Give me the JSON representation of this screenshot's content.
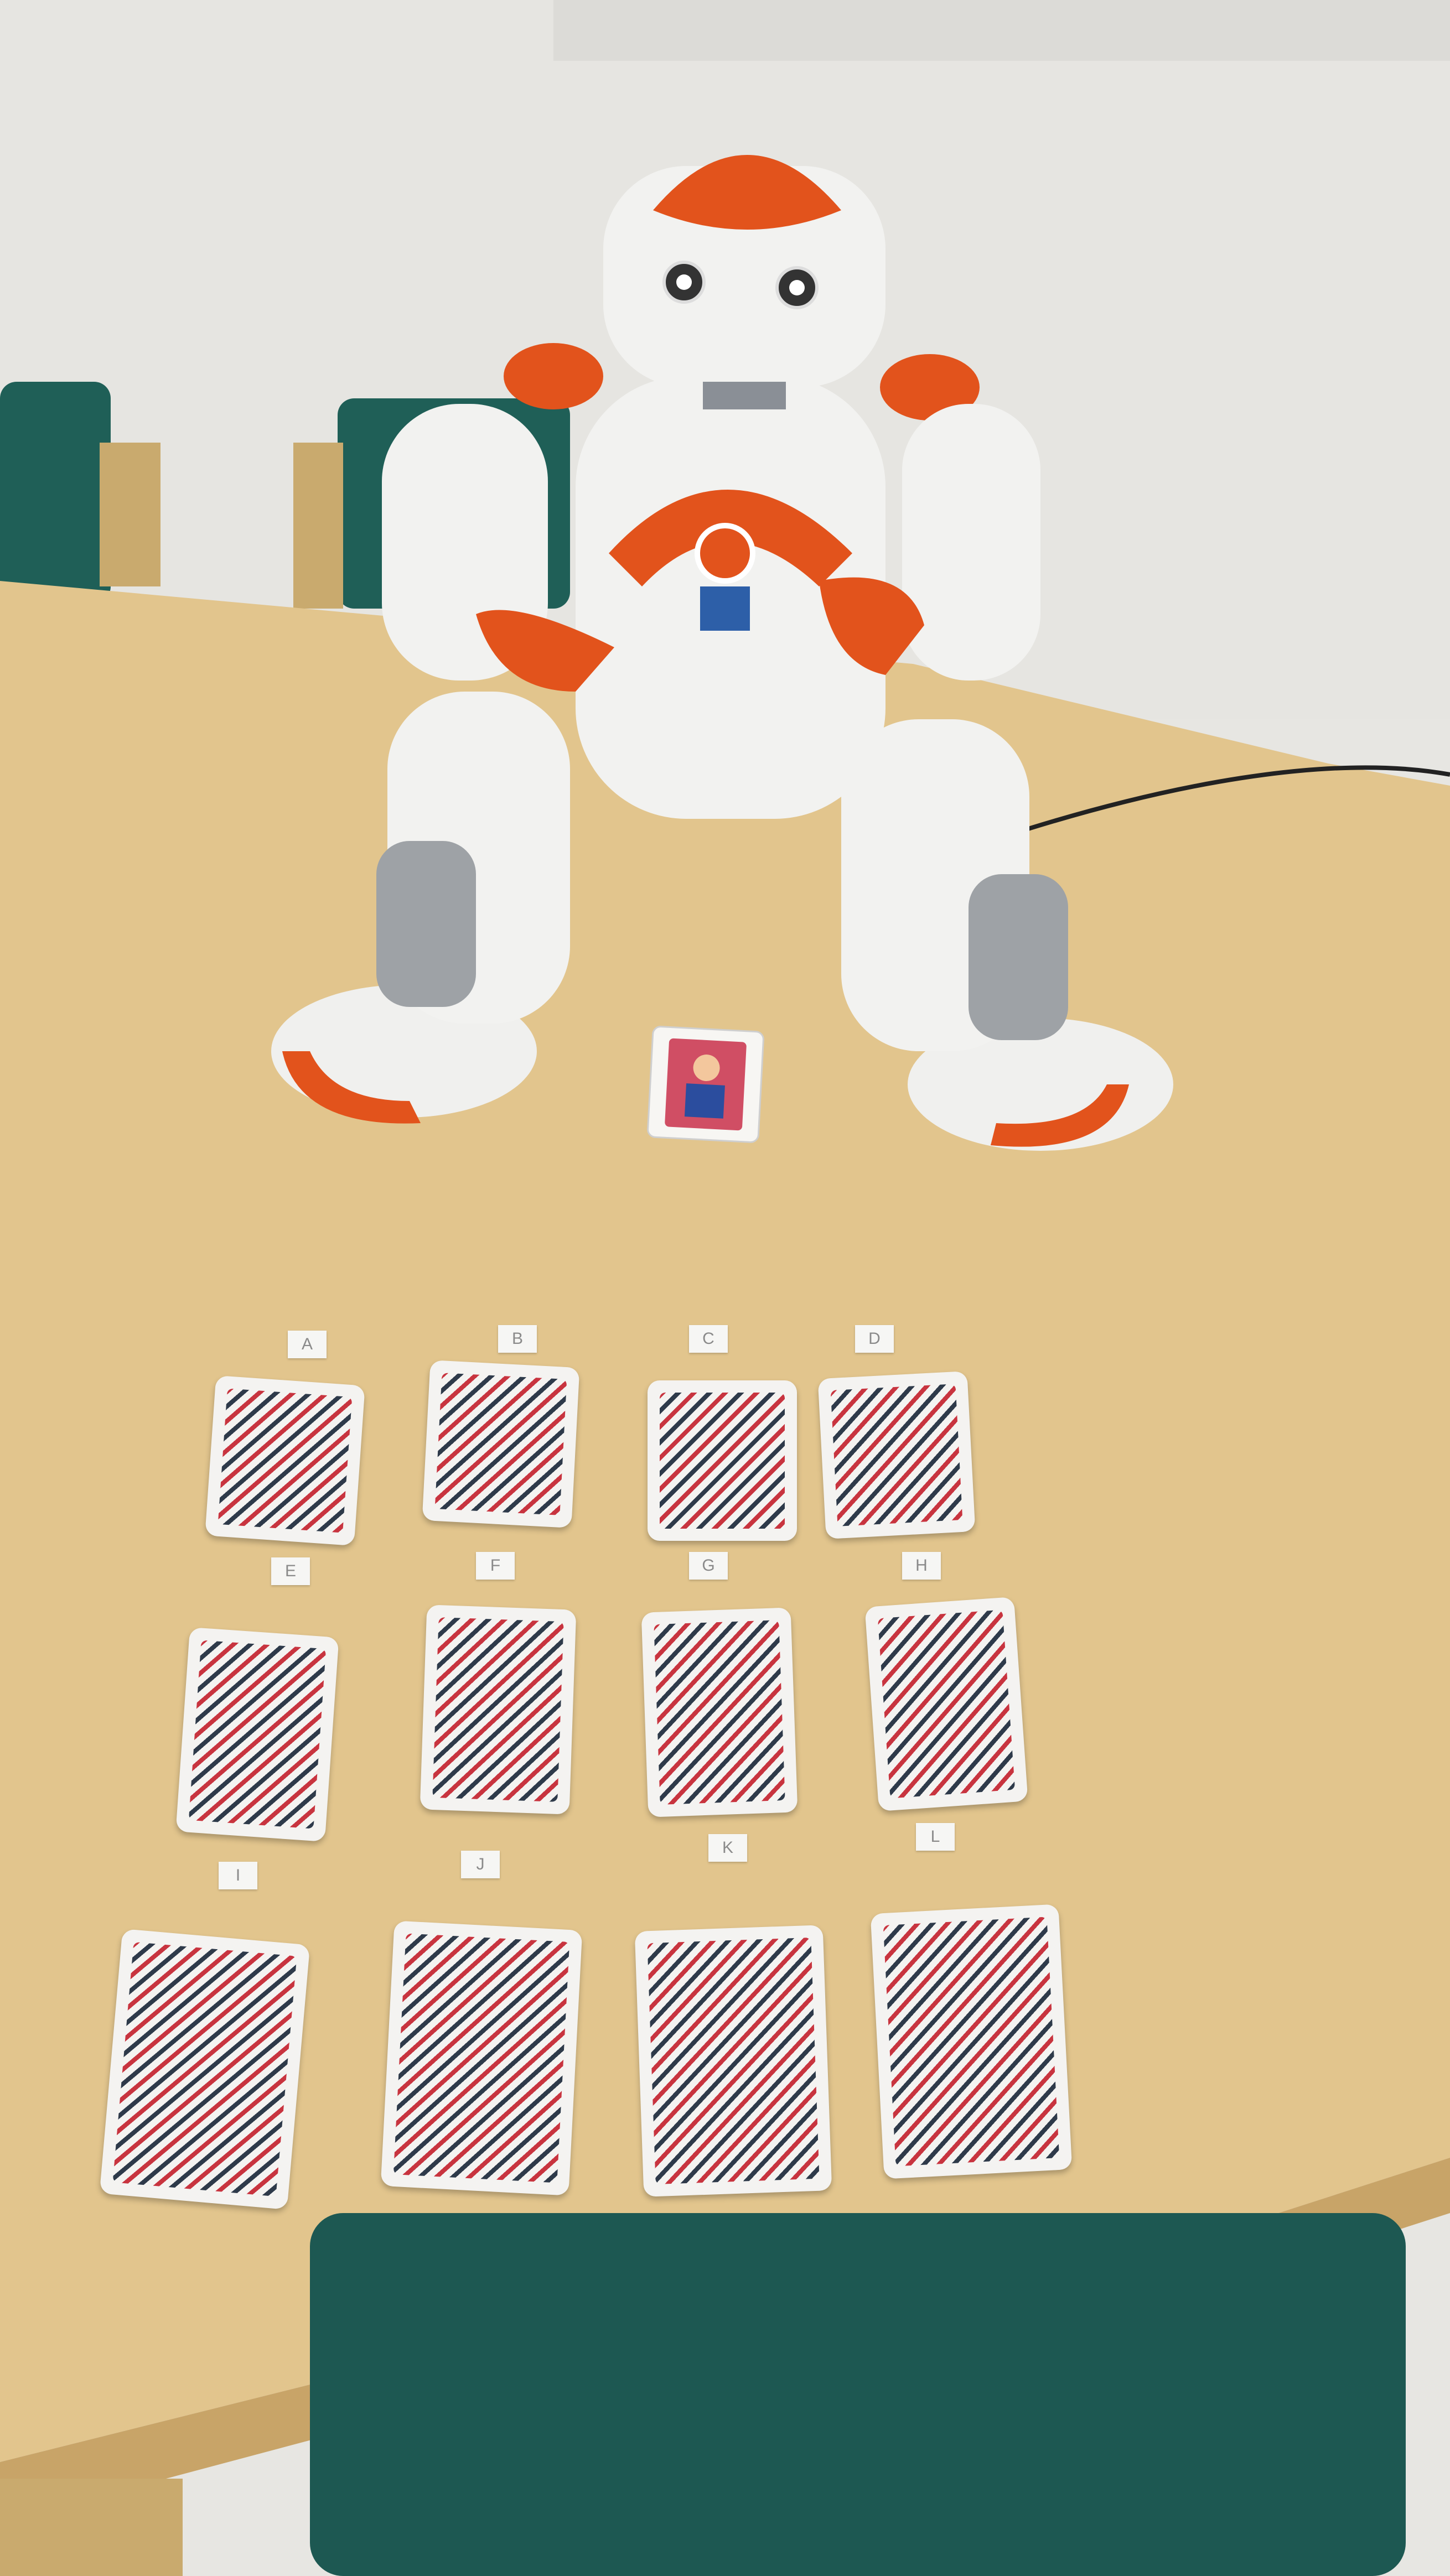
{
  "scene": {
    "colors": {
      "wall": "#e7e6e2",
      "table": "#e2c58d",
      "robot_white": "#f2f2f0",
      "robot_orange": "#e2531c",
      "chair": "#1f5f57"
    }
  },
  "labels": [
    "A",
    "B",
    "C",
    "D",
    "E",
    "F",
    "G",
    "H",
    "I",
    "J",
    "K",
    "L"
  ],
  "face_up_card": {
    "name": "queen-of-hearts"
  }
}
